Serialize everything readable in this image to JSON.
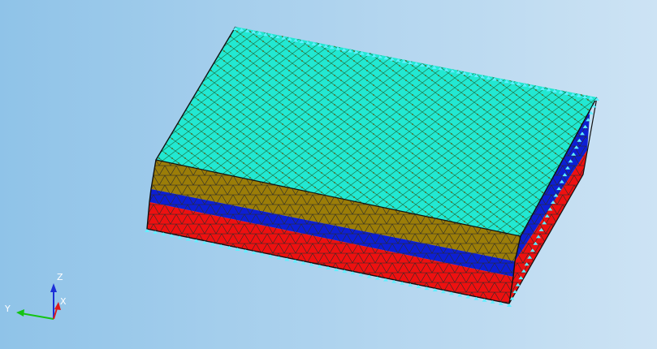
{
  "viewport": {
    "background_left": "#8fc3e8",
    "background_right": "#cde3f4"
  },
  "model": {
    "layers": [
      {
        "name": "top-face",
        "color": "#22e8d2"
      },
      {
        "name": "layer-olive",
        "color": "#9b7d08"
      },
      {
        "name": "layer-blue",
        "color": "#0d1fd4"
      },
      {
        "name": "layer-red",
        "color": "#ee1010"
      }
    ],
    "mesh_line_color": "#2b2b2b",
    "constraint_marker_color": "#5ff0ff"
  },
  "triad": {
    "z_label": "Z",
    "y_label": "Y",
    "x_label": "X",
    "z_color": "#1c2fd8",
    "y_color": "#14c414",
    "x_color": "#e01818"
  }
}
